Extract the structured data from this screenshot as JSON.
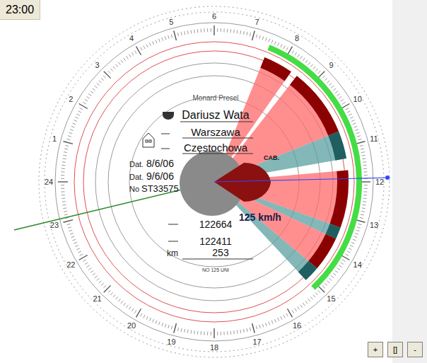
{
  "time": "23:00",
  "disc": {
    "maker": "Monard Presel",
    "driver": "Dariusz Wata",
    "from": "Warszawa",
    "to": "Częstochowa",
    "dates": [
      {
        "label": "Dat.",
        "value": "8/6/06"
      },
      {
        "label": "Dat.",
        "value": "9/6/06"
      }
    ],
    "number": {
      "label": "No",
      "value": "ST33575"
    },
    "cab": "CAB.",
    "max_speed": "125 km/h",
    "odometer_end": "122664",
    "odometer_start": "122411",
    "distance_label": "km",
    "distance": "253",
    "disc_code": "NO 125 UNI",
    "hour_labels": [
      "1",
      "2",
      "3",
      "4",
      "5",
      "6",
      "7",
      "8",
      "9",
      "10",
      "11",
      "12",
      "13",
      "14",
      "15",
      "16",
      "17",
      "18",
      "19",
      "20",
      "21",
      "22",
      "23",
      "24"
    ],
    "shift": {
      "start": 7.47,
      "end": 15.13
    },
    "activities": [
      {
        "kind": "driving",
        "start": 7.47,
        "end": 8.33,
        "color": "#ff6a6a"
      },
      {
        "kind": "driving",
        "start": 8.53,
        "end": 10.53,
        "color": "#ff6a6a"
      },
      {
        "kind": "rest",
        "start": 10.53,
        "end": 11.33,
        "color": "#5a9fa0"
      },
      {
        "kind": "driving",
        "start": 11.67,
        "end": 13.33,
        "color": "#ff6a6a"
      },
      {
        "kind": "rest",
        "start": 13.33,
        "end": 13.67,
        "color": "#5a9fa0"
      },
      {
        "kind": "driving",
        "start": 13.67,
        "end": 14.67,
        "color": "#ff6a6a"
      },
      {
        "kind": "rest",
        "start": 14.67,
        "end": 15.13,
        "color": "#5a9fa0"
      }
    ]
  },
  "zoom_buttons": [
    "+",
    "[]",
    "-"
  ]
}
